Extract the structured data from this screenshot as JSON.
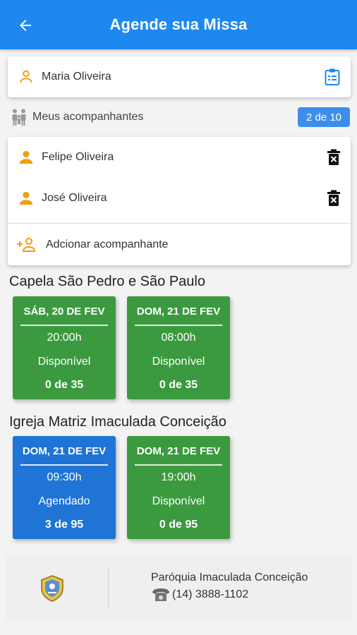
{
  "header": {
    "title": "Agende sua Missa",
    "back_icon": "arrow-left-icon"
  },
  "user": {
    "name": "Maria Oliveira",
    "icon": "person-icon",
    "action_icon": "clipboard-icon"
  },
  "companions": {
    "label": "Meus acompanhantes",
    "counter": "2 de 10",
    "items": [
      {
        "name": "Felipe Oliveira"
      },
      {
        "name": "José Oliveira"
      }
    ],
    "add_label": "Adcionar acompanhante"
  },
  "churches": [
    {
      "name": "Capela São Pedro e São Paulo",
      "masses": [
        {
          "date": "SÁB, 20 DE FEV",
          "time": "20:00h",
          "status": "Disponível",
          "count": "0 de 35",
          "state": "available"
        },
        {
          "date": "DOM, 21 DE FEV",
          "time": "08:00h",
          "status": "Disponível",
          "count": "0 de 35",
          "state": "available"
        }
      ]
    },
    {
      "name": "Igreja Matriz Imaculada Conceição",
      "masses": [
        {
          "date": "DOM, 21 DE FEV",
          "time": "09:30h",
          "status": "Agendado",
          "count": "3 de 95",
          "state": "scheduled"
        },
        {
          "date": "DOM, 21 DE FEV",
          "time": "19:00h",
          "status": "Disponível",
          "count": "0 de 95",
          "state": "available"
        }
      ]
    }
  ],
  "footer": {
    "parish": "Paróquia Imaculada Conceição",
    "phone": "(14) 3888-1102"
  },
  "colors": {
    "primary": "#1e88f0",
    "available": "#3b9a3f",
    "scheduled": "#1f74d6",
    "accent": "#f39c12"
  }
}
